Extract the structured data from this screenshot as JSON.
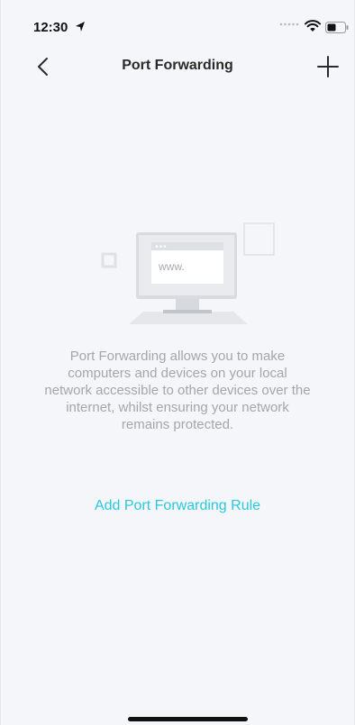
{
  "status_bar": {
    "time": "12:30"
  },
  "nav": {
    "title": "Port Forwarding"
  },
  "empty_state": {
    "illustration_text": "www.",
    "description": "Port Forwarding allows you to make computers and devices on your local network accessible to other devices over the internet, whilst ensuring your network remains protected.",
    "action_label": "Add Port Forwarding Rule"
  },
  "colors": {
    "accent": "#29c8de",
    "background": "#f5f6f9",
    "muted_text": "#a3a6ab"
  }
}
